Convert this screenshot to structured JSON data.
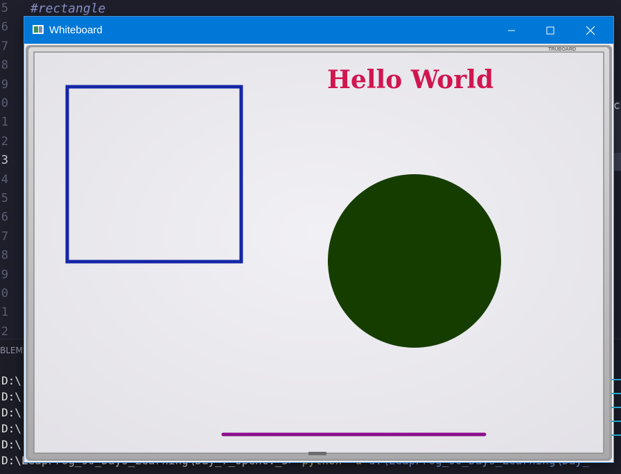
{
  "editor": {
    "comment": "#rectangle",
    "line_numbers": [
      "5",
      "6",
      "7",
      "8",
      "9",
      "0",
      "1",
      "2",
      "3",
      "4",
      "5",
      "6",
      "7",
      "8",
      "9",
      "0",
      "1",
      "2"
    ],
    "active_line": "3",
    "problems_tab": "BLEMS",
    "right_char": "c",
    "terminal_lines": [
      {
        "prefix": "D:\\",
        "rest": ""
      },
      {
        "prefix": "D:\\",
        "rest": ""
      },
      {
        "prefix": "D:\\",
        "rest": ""
      },
      {
        "prefix": "D:\\",
        "rest": ""
      },
      {
        "prefix": "D:\\",
        "rest": ""
      },
      {
        "prefix": "D:\\",
        "rest": "LeapFrog_90_Days_Learning\\Day_7_OpenCV_5>",
        "cmd": "python",
        "arg": "-u",
        "path": "d:\\LeapFrog_90_Days_Learning\\Day_"
      }
    ]
  },
  "window": {
    "title": "Whiteboard",
    "icon": "whiteboard-app-icon",
    "controls": {
      "minimize": "minimize-icon",
      "maximize": "maximize-icon",
      "close": "close-icon"
    },
    "accent_color": "#0078d7"
  },
  "canvas": {
    "board_brand": "TRUBOARD",
    "text_label": "Hello World",
    "text_color": "#d0154f",
    "rectangle_color": "#1426a6",
    "circle_color": "#163d00",
    "line_color": "#8b0f8b",
    "frame_color": "#b9b9bb"
  }
}
